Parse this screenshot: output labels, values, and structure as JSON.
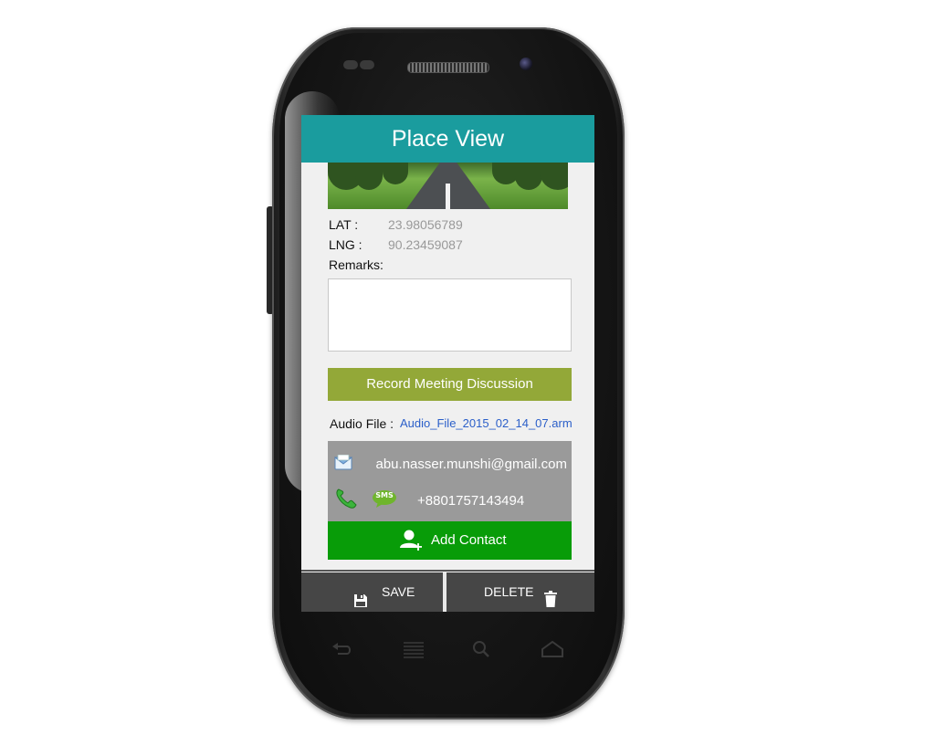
{
  "app": {
    "title": "Place View"
  },
  "location": {
    "lat_label": "LAT :",
    "lat_value": "23.98056789",
    "lng_label": "LNG :",
    "lng_value": "90.23459087",
    "remarks_label": "Remarks:",
    "remarks_value": ""
  },
  "record_button": "Record Meeting Discussion",
  "audio": {
    "label": "Audio File :",
    "file": "Audio_File_2015_02_14_07.arm"
  },
  "contact": {
    "email": "abu.nasser.munshi@gmail.com",
    "phone": "+8801757143494",
    "sms_badge": "SMS",
    "add_label": "Add Contact"
  },
  "bottom_bar": {
    "save_label": "SAVE",
    "delete_label": "DELETE"
  },
  "colors": {
    "titlebar": "#1a9c9e",
    "record_button": "#93a838",
    "add_contact": "#089c08",
    "contact_box": "#9a9a9a",
    "bottom_bar": "#464646",
    "link": "#2b5fc9"
  }
}
